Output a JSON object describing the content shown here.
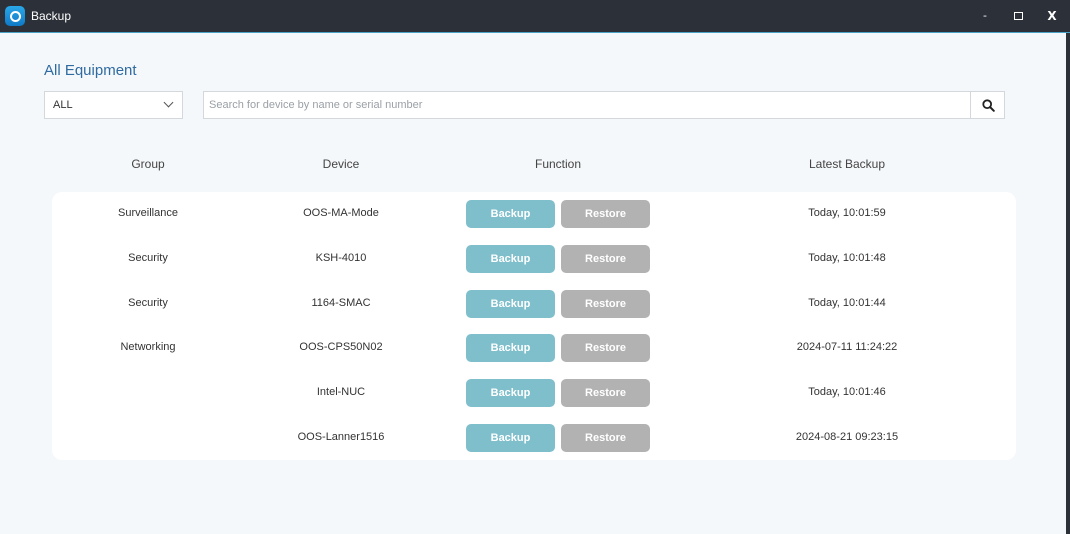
{
  "window": {
    "title": "Backup",
    "minimize_label": "-",
    "close_label": "X"
  },
  "page": {
    "title": "All Equipment"
  },
  "filter": {
    "selected": "ALL"
  },
  "search": {
    "placeholder": "Search for device by name or serial number",
    "value": ""
  },
  "table": {
    "headers": {
      "group": "Group",
      "device": "Device",
      "function": "Function",
      "latest_backup": "Latest Backup"
    },
    "rows": [
      {
        "group": "Surveillance",
        "device": "OOS-MA-Mode",
        "backup_label": "Backup",
        "restore_label": "Restore",
        "latest_backup": "Today, 10:01:59"
      },
      {
        "group": "Security",
        "device": "KSH-4010",
        "backup_label": "Backup",
        "restore_label": "Restore",
        "latest_backup": "Today, 10:01:48"
      },
      {
        "group": "Security",
        "device": "1164-SMAC",
        "backup_label": "Backup",
        "restore_label": "Restore",
        "latest_backup": "Today, 10:01:44"
      },
      {
        "group": "Networking",
        "device": "OOS-CPS50N02",
        "backup_label": "Backup",
        "restore_label": "Restore",
        "latest_backup": "2024-07-11 11:24:22"
      },
      {
        "group": "",
        "device": "Intel-NUC",
        "backup_label": "Backup",
        "restore_label": "Restore",
        "latest_backup": "Today, 10:01:46"
      },
      {
        "group": "",
        "device": "OOS-Lanner1516",
        "backup_label": "Backup",
        "restore_label": "Restore",
        "latest_backup": "2024-08-21 09:23:15"
      }
    ]
  },
  "colors": {
    "titlebar": "#2c3038",
    "accent_title": "#2f6aa0",
    "backup_button": "#7fbfcc",
    "restore_button": "#b2b2b2",
    "background": "#f5f8fb"
  }
}
